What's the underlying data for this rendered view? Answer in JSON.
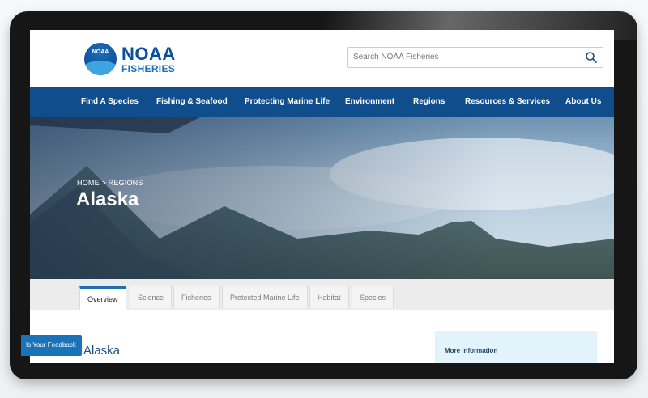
{
  "header": {
    "logo": {
      "seal": "NOAA",
      "name": "NOAA",
      "sub": "FISHERIES"
    },
    "search": {
      "placeholder": "Search NOAA Fisheries"
    }
  },
  "nav": {
    "items": [
      {
        "label": "Find A Species"
      },
      {
        "label": "Fishing & Seafood"
      },
      {
        "label": "Protecting Marine Life"
      },
      {
        "label": "Environment"
      },
      {
        "label": "Regions"
      },
      {
        "label": "Resources & Services"
      },
      {
        "label": "About Us"
      }
    ],
    "color": "#0f4d8c"
  },
  "hero": {
    "breadcrumb": "HOME > REGIONS",
    "title": "Alaska"
  },
  "tabs": [
    {
      "label": "Overview",
      "active": true
    },
    {
      "label": "Science"
    },
    {
      "label": "Fisheries"
    },
    {
      "label": "Protected Marine Life"
    },
    {
      "label": "Habitat"
    },
    {
      "label": "Species"
    }
  ],
  "content": {
    "title": "Alaska",
    "info_panel_title": "More Information"
  },
  "feedback": {
    "label": "Is Your Feedback"
  },
  "colors": {
    "accent": "#1c6fb8",
    "nav": "#0f4d8c",
    "panel": "#e3f3fb"
  }
}
